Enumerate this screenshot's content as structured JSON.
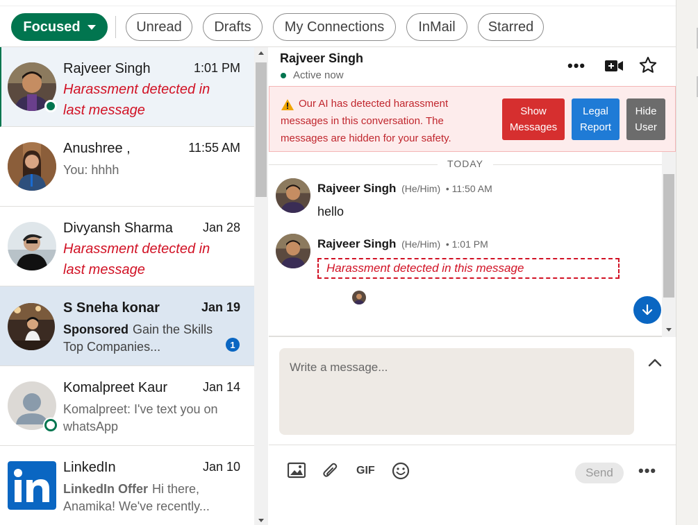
{
  "filters": {
    "focused": "Focused",
    "unread": "Unread",
    "drafts": "Drafts",
    "my_connections": "My Connections",
    "inmail": "InMail",
    "starred": "Starred"
  },
  "conversations": [
    {
      "name": "Rajveer Singh",
      "time": "1:01 PM",
      "snippet": "Harassment detected in last message"
    },
    {
      "name": "Anushree ,",
      "time": "11:55 AM",
      "snippet": "You: hhhh"
    },
    {
      "name": "Divyansh Sharma",
      "time": "Jan 28",
      "snippet": "Harassment detected in last message"
    },
    {
      "name": "S Sneha konar",
      "time": "Jan 19",
      "sponsor_label": "Sponsored",
      "snippet": "Gain the Skills Top Companies...",
      "unread_count": "1"
    },
    {
      "name": "Komalpreet Kaur",
      "time": "Jan 14",
      "snippet": "Komalpreet: I've text you on whatsApp"
    },
    {
      "name": "LinkedIn",
      "time": "Jan 10",
      "sponsor_label": "LinkedIn Offer",
      "snippet": "Hi there, Anamika! We've recently..."
    }
  ],
  "thread": {
    "name": "Rajveer Singh",
    "status": "Active now",
    "more": "•••",
    "alert": {
      "text": "Our AI has detected harassment messages in this conversation. The messages are hidden for your safety.",
      "show_btn": "Show Messages",
      "legal_btn": "Legal Report",
      "hide_btn": "Hide User"
    },
    "day_label": "TODAY",
    "messages": [
      {
        "sender": "Rajveer Singh",
        "pronouns": "(He/Him)",
        "time": "• 11:50 AM",
        "text": "hello"
      },
      {
        "sender": "Rajveer Singh",
        "pronouns": "(He/Him)",
        "time": "• 1:01 PM",
        "text": "Harassment detected in this message"
      }
    ]
  },
  "composer": {
    "placeholder": "Write a message...",
    "gif": "GIF",
    "send": "Send",
    "more": "•••"
  },
  "colors": {
    "brand_green": "#01754f",
    "harassment_red": "#d11124",
    "link_blue": "#0a66c2"
  },
  "icons": [
    "chevron-down-icon",
    "video-icon",
    "star-icon",
    "warning-icon",
    "arrow-down-icon",
    "image-icon",
    "paperclip-icon",
    "emoji-icon",
    "chevron-up-icon",
    "linkedin-logo"
  ]
}
